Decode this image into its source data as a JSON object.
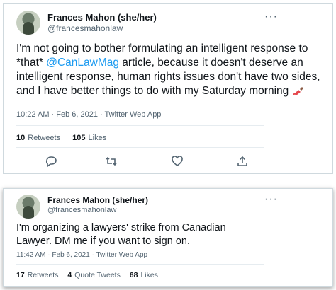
{
  "tweet1": {
    "name": "Frances Mahon (she/her)",
    "handle": "@francesmahonlaw",
    "text_before": "I'm not going to bother formulating an intelligent response to *that* ",
    "mention": "@CanLawMag",
    "text_after": " article, because it doesn't deserve an intelligent response, human rights issues don't have two sides, and I have better things to do with my Saturday morning ",
    "emoji": "nail-polish-emoji",
    "meta": "10:22 AM · Feb 6, 2021 · Twitter Web App",
    "retweets_count": "10",
    "retweets_label": "Retweets",
    "likes_count": "105",
    "likes_label": "Likes",
    "more": "···"
  },
  "tweet2": {
    "name": "Frances Mahon (she/her)",
    "handle": "@francesmahonlaw",
    "text": "I'm organizing a lawyers' strike from Canadian Lawyer. DM me if you want to sign on.",
    "meta": "11:42 AM · Feb 6, 2021 · Twitter Web App",
    "retweets_count": "17",
    "retweets_label": "Retweets",
    "quotes_count": "4",
    "quotes_label": "Quote Tweets",
    "likes_count": "68",
    "likes_label": "Likes",
    "more": "···"
  },
  "colors": {
    "accent": "#1d9bf0",
    "secondary_text": "#536471",
    "border": "#cfd9de"
  }
}
